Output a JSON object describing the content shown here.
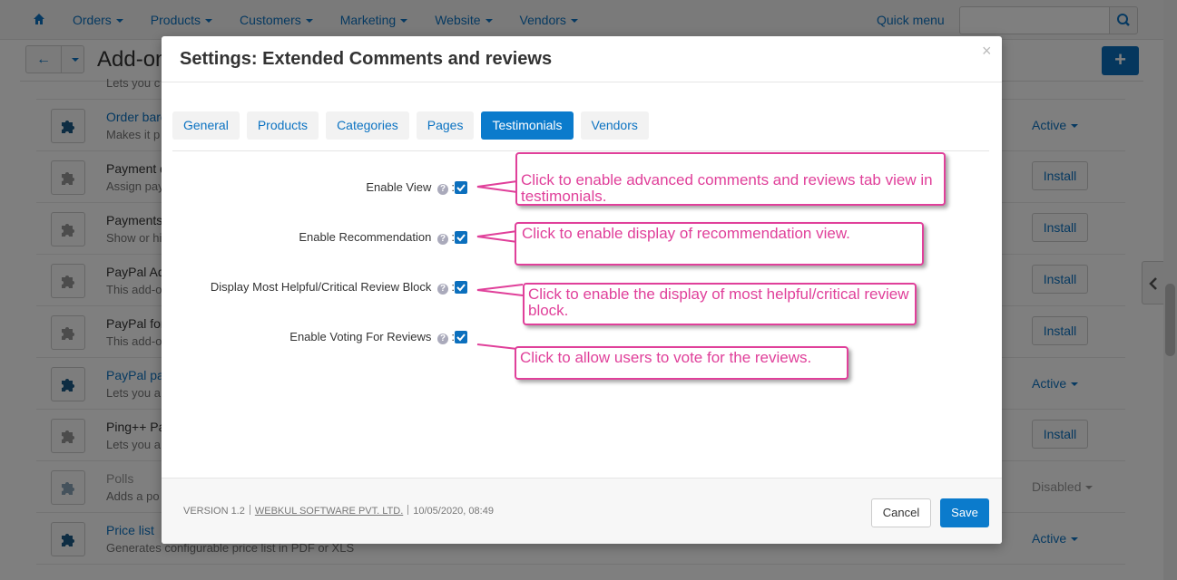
{
  "colors": {
    "accent": "#0b7bcc",
    "link": "#0c73c2",
    "annotation": "#e0409a"
  },
  "topnav": {
    "items": [
      {
        "label": "Orders"
      },
      {
        "label": "Products"
      },
      {
        "label": "Customers"
      },
      {
        "label": "Marketing"
      },
      {
        "label": "Website"
      },
      {
        "label": "Vendors"
      }
    ],
    "quick_menu": "Quick menu",
    "search_placeholder": ""
  },
  "page": {
    "title": "Add-ons"
  },
  "addons": [
    {
      "name": "",
      "desc": "Lets you c",
      "state": "none"
    },
    {
      "name": "Order barc",
      "desc": "Makes it p",
      "state": "Active"
    },
    {
      "name": "Payment d",
      "desc": "Assign pay",
      "state": "Install"
    },
    {
      "name": "Payments",
      "desc": "Show or hi",
      "state": "Install"
    },
    {
      "name": "PayPal Ad",
      "desc": "This add-o",
      "state": "Install"
    },
    {
      "name": "PayPal for",
      "desc": "This add-o",
      "state": "Install"
    },
    {
      "name": "PayPal pay",
      "desc": "Lets you a",
      "state": "Active"
    },
    {
      "name": "Ping++ Pa",
      "desc": "Lets you a",
      "state": "Install"
    },
    {
      "name": "Polls",
      "desc": "Adds a po",
      "state": "Disabled"
    },
    {
      "name": "Price list",
      "desc": "Generates configurable price list in PDF or XLS",
      "state": "Active"
    }
  ],
  "modal": {
    "title": "Settings: Extended Comments and reviews",
    "close": "×",
    "tabs": [
      {
        "label": "General",
        "active": false
      },
      {
        "label": "Products",
        "active": false
      },
      {
        "label": "Categories",
        "active": false
      },
      {
        "label": "Pages",
        "active": false
      },
      {
        "label": "Testimonials",
        "active": true
      },
      {
        "label": "Vendors",
        "active": false
      }
    ],
    "fields": [
      {
        "label": "Enable View",
        "checked": true
      },
      {
        "label": "Enable Recommendation",
        "checked": true
      },
      {
        "label": "Display Most Helpful/Critical Review Block",
        "checked": true
      },
      {
        "label": "Enable Voting For Reviews",
        "checked": true
      }
    ],
    "callouts": [
      "Click to enable advanced comments and reviews tab view in  testimonials.",
      "Click to enable display of recommendation view.",
      "Click to enable the display of most helpful/critical review block.",
      "Click to allow users to vote for the reviews."
    ],
    "footer": {
      "version": "VERSION 1.2",
      "vendor": "WEBKUL SOFTWARE PVT. LTD.",
      "date": "10/05/2020, 08:49",
      "cancel": "Cancel",
      "save": "Save"
    }
  }
}
